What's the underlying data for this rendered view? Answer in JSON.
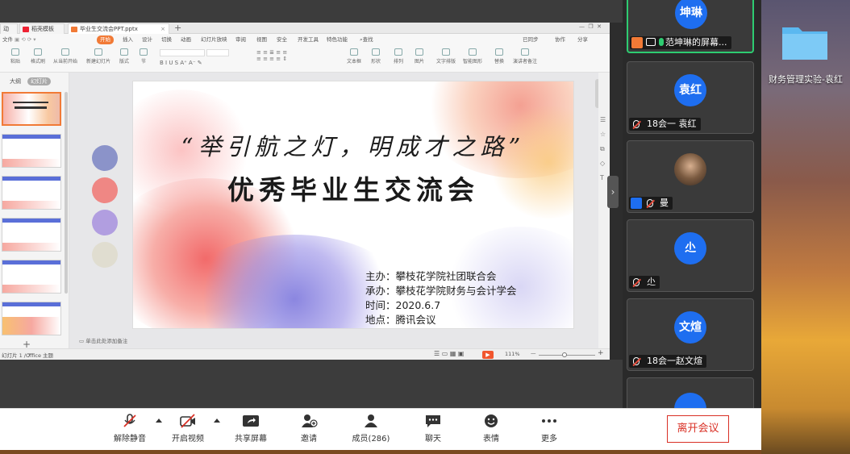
{
  "wps": {
    "tabs": [
      "动",
      "稻壳模板",
      "毕业生交流会PPT.pptx"
    ],
    "menu_file": "文件",
    "menu": [
      "开始",
      "插入",
      "设计",
      "切换",
      "动画",
      "幻灯片放映",
      "审阅",
      "视图",
      "安全",
      "开发工具",
      "特色功能",
      "查找"
    ],
    "menu_right": [
      "已同步",
      "协作",
      "分享"
    ],
    "toolbar_items": [
      "粘贴",
      "格式刷",
      "从当前开始",
      "新建幻灯片",
      "版式",
      "节",
      "重置",
      "文本框",
      "形状",
      "排列",
      "图片",
      "文字排版",
      "智能图形",
      "替换",
      "演讲者备注"
    ],
    "left_tabs": [
      "大纲",
      "幻灯片"
    ],
    "thumb_numbers": [
      "1",
      "2",
      "3",
      "4",
      "5",
      "6"
    ],
    "slide": {
      "title_line1": "“举引航之灯，明成才之路”",
      "title_line2": "优秀毕业生交流会",
      "info": [
        "主办：攀枝花学院社团联合会",
        "承办：攀枝花学院财务与会计学会",
        "时间：2020.6.7",
        "地点：腾讯会议"
      ],
      "swatches": [
        "#8b93c9",
        "#ef8784",
        "#b19ee0",
        "#e0ddd0"
      ]
    },
    "notes_hint": "单击此处添加备注",
    "status_left": "幻灯片 1 / 7",
    "status_theme": "Office 主题",
    "zoom": "111%"
  },
  "participants": [
    {
      "avatar": "坤琳",
      "name": "范坤琳的屏幕...",
      "active": true
    },
    {
      "avatar": "袁红",
      "name": "18会一 袁红",
      "active": false
    },
    {
      "avatar": "",
      "name": "曼",
      "active": false
    },
    {
      "avatar": "尐",
      "name": "尐",
      "active": false
    },
    {
      "avatar": "文煊",
      "name": "18会一赵文煊",
      "active": false
    }
  ],
  "toolbar": {
    "mute": "解除静音",
    "video": "开启视频",
    "share": "共享屏幕",
    "invite": "邀请",
    "members": "成员(286)",
    "chat": "聊天",
    "emoji": "表情",
    "more": "更多",
    "leave": "离开会议"
  },
  "desktop": {
    "folder_label": "财务管理实验-袁红"
  }
}
